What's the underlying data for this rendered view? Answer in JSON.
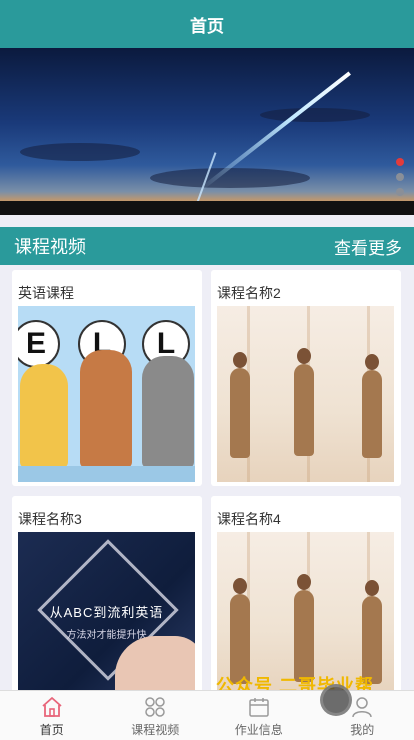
{
  "header": {
    "title": "首页"
  },
  "banner": {
    "slides": 3,
    "active_index": 0
  },
  "section": {
    "title": "课程视频",
    "more": "查看更多"
  },
  "courses": [
    {
      "title": "英语课程",
      "image": "cartoon-ell"
    },
    {
      "title": "课程名称2",
      "image": "yoga-class"
    },
    {
      "title": "课程名称3",
      "image": "english-poster",
      "poster_line1": "从ABC到流利英语",
      "poster_line2": "方法对才能提升快"
    },
    {
      "title": "课程名称4",
      "image": "yoga-class"
    }
  ],
  "ell_letters": [
    "E",
    "L",
    "L"
  ],
  "watermark": "公众号 二哥毕业帮",
  "tabs": [
    {
      "label": "首页",
      "icon": "home-icon",
      "active": true
    },
    {
      "label": "课程视频",
      "icon": "grid-icon",
      "active": false
    },
    {
      "label": "作业信息",
      "icon": "calendar-icon",
      "active": false
    },
    {
      "label": "我的",
      "icon": "user-icon",
      "active": false
    }
  ],
  "colors": {
    "primary": "#2a9a9b",
    "active_dot": "#e23b3b",
    "watermark": "#f0b800",
    "home_icon": "#e8657a"
  }
}
